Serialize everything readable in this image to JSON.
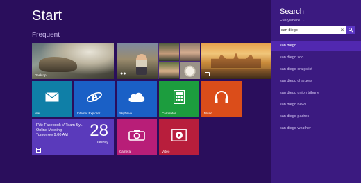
{
  "start": {
    "title": "Start",
    "group_label": "Frequent"
  },
  "tiles": {
    "desktop": {
      "label": "Desktop"
    },
    "photos": {
      "icon": "people-icon"
    },
    "travel": {
      "icon": "travel-icon"
    },
    "mail": {
      "label": "Mail",
      "color": "#0f7fa7",
      "icon": "envelope-icon"
    },
    "ie": {
      "label": "Internet Explorer",
      "color": "#1a60c6",
      "icon": "internet-explorer-icon"
    },
    "skydrive": {
      "label": "SkyDrive",
      "color": "#1a60c6",
      "icon": "cloud-icon"
    },
    "calculator": {
      "label": "Calculator",
      "color": "#1c9d3e",
      "icon": "calculator-icon"
    },
    "music": {
      "label": "Music",
      "color": "#db4d1a",
      "icon": "headphones-icon"
    },
    "calendar": {
      "color": "#5a3abb",
      "event_line1": "FW: Facebook V-Team Sy...",
      "event_line2": "Online Meeting",
      "event_line3": "Tomorrow 9:00 AM",
      "date": "28",
      "day": "Tuesday"
    },
    "camera": {
      "label": "Camera",
      "color": "#b81e78",
      "icon": "camera-icon"
    },
    "video": {
      "label": "Video",
      "color": "#b81e3c",
      "icon": "play-icon"
    }
  },
  "search": {
    "title": "Search",
    "scope": "Everywhere",
    "query": "san diego",
    "suggestions": [
      "san diego",
      "san diego zoo",
      "san diego craigslist",
      "san diego chargers",
      "san diego union tribune",
      "san diego news",
      "san diego padres",
      "san diego weather"
    ]
  }
}
